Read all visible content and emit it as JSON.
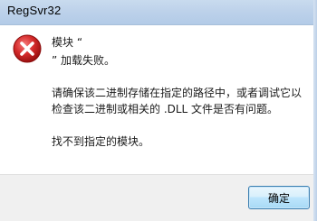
{
  "window": {
    "title": "RegSvr32"
  },
  "dialog": {
    "icon": "error-icon",
    "line1": "模块 “",
    "line2": "” 加载失败。",
    "paragraph1": "请确保该二进制存储在指定的路径中，或者调试它以检查该二进制或相关的 .DLL 文件是否有问题。",
    "paragraph2": "找不到指定的模块。"
  },
  "buttons": {
    "ok_label": "确定"
  },
  "colors": {
    "error_red": "#d42a2a",
    "titlebar": "#bcd1ea",
    "footer": "#f0f0f0",
    "button_border": "#3c7fb1"
  }
}
